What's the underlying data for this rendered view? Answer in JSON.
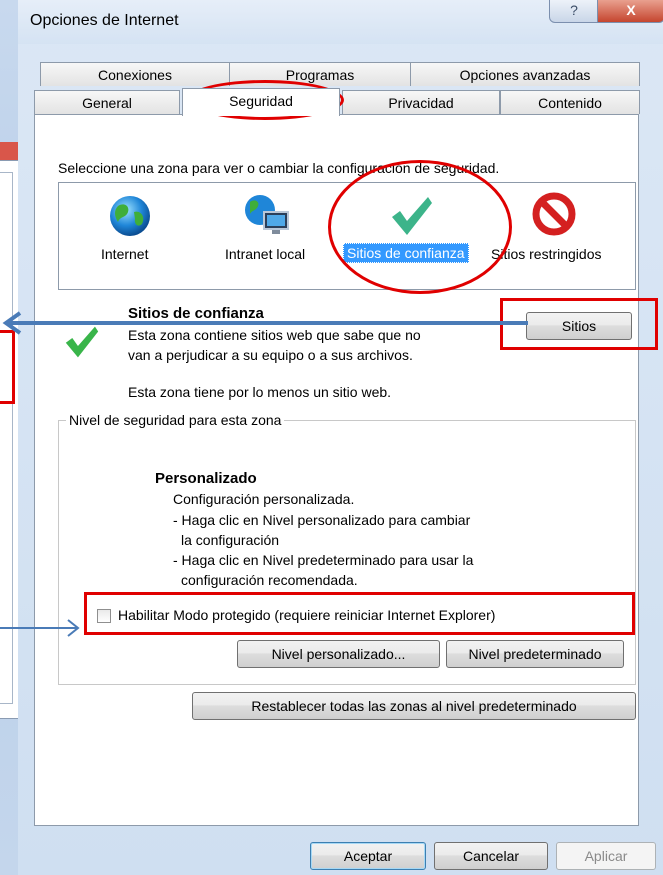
{
  "window": {
    "title": "Opciones de Internet",
    "help_glyph": "?",
    "close_glyph": "X"
  },
  "tabs": {
    "row1": [
      "Conexiones",
      "Programas",
      "Opciones avanzadas"
    ],
    "row2": [
      "General",
      "Seguridad",
      "Privacidad",
      "Contenido"
    ],
    "active": "Seguridad"
  },
  "zones": {
    "instruction": "Seleccione una zona para ver o cambiar la configuración de seguridad.",
    "items": [
      {
        "label": "Internet",
        "icon": "globe-icon"
      },
      {
        "label": "Intranet local",
        "icon": "intranet-globe-icon"
      },
      {
        "label": "Sitios de confianza",
        "icon": "green-checkmark-icon",
        "selected": true
      },
      {
        "label": "Sitios restringidos",
        "icon": "restricted-no-icon"
      }
    ]
  },
  "selected_zone": {
    "title": "Sitios de confianza",
    "description_line1": "Esta zona contiene sitios web que sabe que no",
    "description_line2": "van a perjudicar a su equipo o a sus archivos.",
    "note": "Esta zona tiene por lo menos un sitio web.",
    "sites_button": "Sitios"
  },
  "security_level": {
    "group_label": "Nivel de seguridad para esta zona",
    "level_title": "Personalizado",
    "lines": [
      "Configuración personalizada.",
      "- Haga clic en Nivel personalizado para cambiar",
      "la configuración",
      "- Haga clic en Nivel predeterminado para usar la",
      "configuración recomendada."
    ],
    "protected_mode_label": "Habilitar Modo protegido (requiere reiniciar Internet Explorer)",
    "protected_mode_checked": false,
    "custom_level_button": "Nivel personalizado...",
    "default_level_button": "Nivel predeterminado",
    "reset_all_button": "Restablecer todas las zonas al nivel predeterminado"
  },
  "footer": {
    "ok": "Aceptar",
    "cancel": "Cancelar",
    "apply": "Aplicar"
  },
  "colors": {
    "annotation_red": "#e00000",
    "arrow_blue": "#4a7bb7",
    "selection_blue": "#3399ff"
  }
}
